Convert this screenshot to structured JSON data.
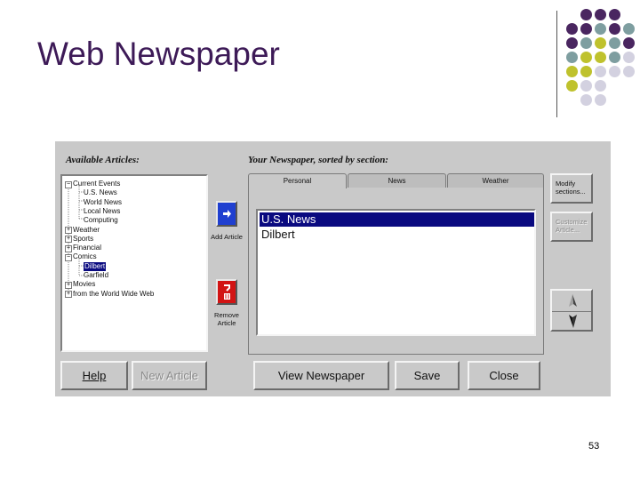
{
  "slide": {
    "title": "Web Newspaper",
    "page_number": "53",
    "colors": {
      "purple": "#4a2660",
      "teal": "#7e9ea0",
      "olive": "#bfc22d",
      "lavender": "#d3d1e0"
    }
  },
  "app": {
    "available_label": "Available Articles:",
    "newspaper_label": "Your Newspaper, sorted by section:",
    "tree": [
      {
        "label": "Current Events",
        "toggle": "−"
      },
      {
        "label": "U.S. News"
      },
      {
        "label": "World News"
      },
      {
        "label": "Local News"
      },
      {
        "label": "Computing"
      },
      {
        "label": "Weather",
        "toggle": "+"
      },
      {
        "label": "Sports",
        "toggle": "+"
      },
      {
        "label": "Financial",
        "toggle": "+"
      },
      {
        "label": "Comics",
        "toggle": "−"
      },
      {
        "label": "Dilbert",
        "selected": true
      },
      {
        "label": "Garfield"
      },
      {
        "label": "Movies",
        "toggle": "+"
      },
      {
        "label": "from the World Wide Web",
        "toggle": "+"
      }
    ],
    "add_article_label": "Add Article",
    "remove_article_label": "Remove Article",
    "tabs": [
      "Personal",
      "News",
      "Weather"
    ],
    "active_tab": "Personal",
    "newspaper_items": [
      "U.S. News",
      "Dilbert"
    ],
    "selected_item": "U.S. News",
    "modify_sections_label": "Modify sections...",
    "customize_article_label": "Customize Article...",
    "buttons": {
      "help": "Help",
      "new_article": "New Article",
      "view_newspaper": "View Newspaper",
      "save": "Save",
      "close": "Close"
    },
    "icons": {
      "add": "arrow-right-icon",
      "remove": "trash-icon",
      "move_up": "arrow-up-icon",
      "move_down": "arrow-down-icon"
    }
  }
}
